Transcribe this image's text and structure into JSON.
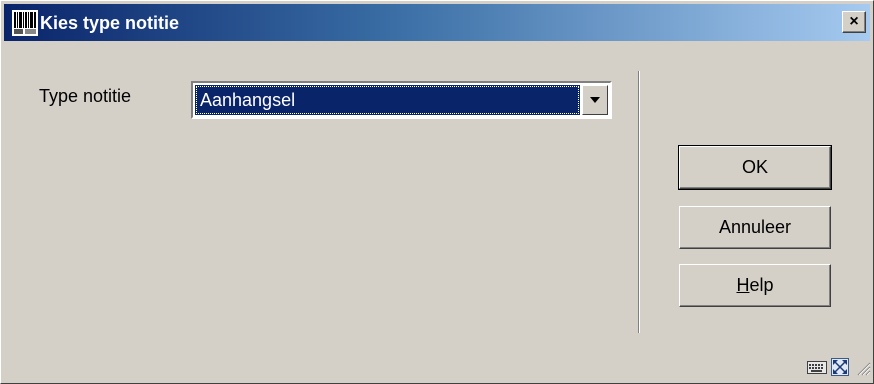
{
  "window": {
    "title": "Kies type notitie",
    "close_label": "×"
  },
  "form": {
    "type_label": "Type notitie",
    "type_value": "Aanhangsel"
  },
  "buttons": {
    "ok_label": "OK",
    "cancel_label": "Annuleer",
    "help_mnemonic": "H",
    "help_rest": "elp"
  },
  "icons": {
    "title_icon": "barcode-app-icon",
    "dropdown_arrow": "chevron-down-icon",
    "keyboard": "keyboard-icon",
    "maximize": "expand-arrows-icon",
    "resize_grip": "resize-grip-icon"
  },
  "colors": {
    "title_start": "#0a246a",
    "title_end": "#a6caf0",
    "selection": "#0a246a",
    "face": "#d4d0c8"
  }
}
